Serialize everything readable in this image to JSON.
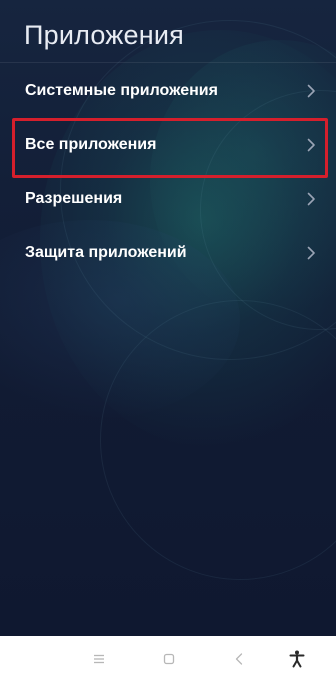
{
  "header": {
    "title": "Приложения"
  },
  "menu": {
    "items": [
      {
        "label": "Системные приложения"
      },
      {
        "label": "Все приложения"
      },
      {
        "label": "Разрешения"
      },
      {
        "label": "Защита приложений"
      }
    ]
  },
  "nav": {
    "icons": [
      "menu-icon",
      "home-icon",
      "back-icon",
      "accessibility-icon"
    ]
  },
  "colors": {
    "background_top": "#16253f",
    "background_bottom": "#0f1830",
    "highlight_border": "#d51f2c",
    "text": "#ffffff",
    "chevron": "#9aa4b5",
    "nav_icon": "#b7b7b7"
  }
}
